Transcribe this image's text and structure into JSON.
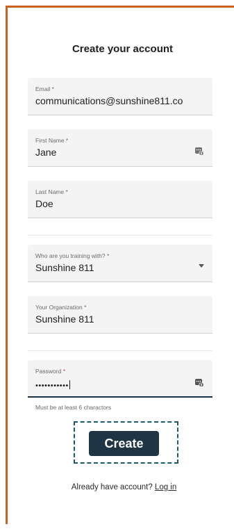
{
  "form": {
    "title": "Create your account",
    "email": {
      "label": "Email *",
      "value": "communications@sunshine811.co"
    },
    "first_name": {
      "label": "First Name *",
      "value": "Jane"
    },
    "last_name": {
      "label": "Last Name *",
      "value": "Doe"
    },
    "training_with": {
      "label": "Who are you training with? *",
      "value": "Sunshine 811"
    },
    "organization": {
      "label": "Your Organization *",
      "value": "Sunshine 811"
    },
    "password": {
      "label": "Password",
      "required_mark": "*",
      "value": "•••••••••••"
    },
    "password_hint": "Must be at least 6 charactors",
    "create_label": "Create",
    "footer_text": "Already have account?",
    "login_label": "Log in"
  },
  "colors": {
    "accent": "#c7621f",
    "button": "#1f3444",
    "focus_outline": "#1b5a6e"
  },
  "icons": {
    "key_icon": "password-manager-key-icon",
    "dropdown_icon": "chevron-down-icon"
  }
}
